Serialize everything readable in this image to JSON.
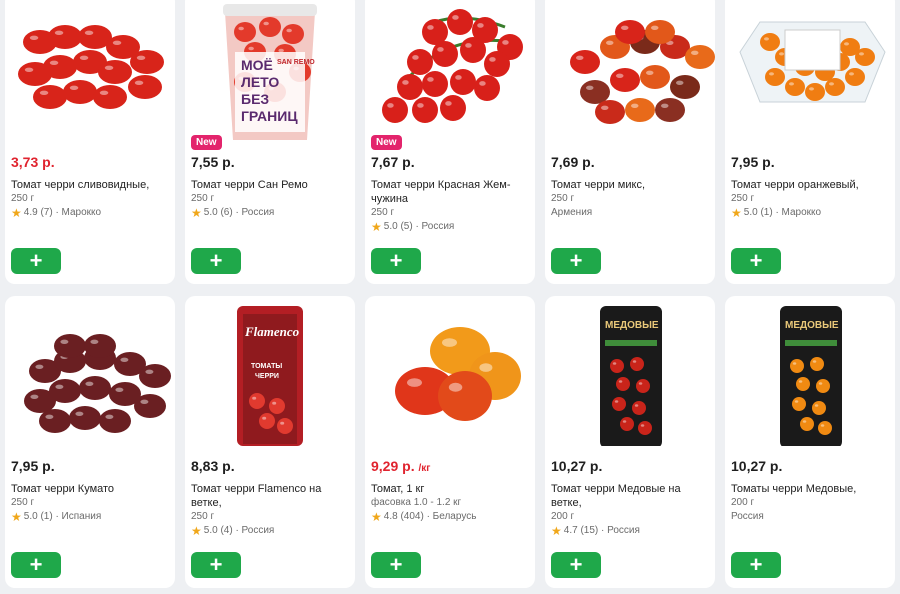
{
  "products": [
    {
      "price": "3,73 р.",
      "price_red": true,
      "unit": "",
      "badge": "",
      "title": "Томат черри сливовидные,",
      "weight": "250 г",
      "rating": "4.9 (7)",
      "country": "Марокко",
      "image": "red-plum-cherry-tomatoes"
    },
    {
      "price": "7,55 р.",
      "price_red": false,
      "unit": "",
      "badge": "New",
      "title": "Томат черри Сан Ремо",
      "weight": "250 г",
      "rating": "5.0 (6)",
      "country": "Россия",
      "image": "san-remo-cup",
      "image_text": [
        "МОЁ",
        "ЛЕТО",
        "БЕЗ",
        "ГРАНИЦ"
      ],
      "brand": "SAN REMO"
    },
    {
      "price": "7,67 р.",
      "price_red": false,
      "unit": "",
      "badge": "New",
      "title": "Томат черри Красная Жем-чужина",
      "weight": "250 г",
      "rating": "5.0 (5)",
      "country": "Россия",
      "image": "cherry-tomatoes-on-vine"
    },
    {
      "price": "7,69 р.",
      "price_red": false,
      "unit": "",
      "badge": "",
      "title": "Томат черри микс,",
      "weight": "250 г",
      "rating": "",
      "country": "Армения",
      "image": "mixed-cherry-tomatoes"
    },
    {
      "price": "7,95 р.",
      "price_red": false,
      "unit": "",
      "badge": "",
      "title": "Томат черри оранжевый,",
      "weight": "250 г",
      "rating": "5.0 (1)",
      "country": "Марокко",
      "image": "orange-cherry-tray"
    },
    {
      "price": "7,95 р.",
      "price_red": false,
      "unit": "",
      "badge": "",
      "title": "Томат черри Кумато",
      "weight": "250 г",
      "rating": "5.0 (1)",
      "country": "Испания",
      "image": "kumato-tomatoes"
    },
    {
      "price": "8,83 р.",
      "price_red": false,
      "unit": "",
      "badge": "",
      "title": "Томат черри Flamenco на ветке,",
      "weight": "250 г",
      "rating": "5.0 (4)",
      "country": "Россия",
      "image": "flamenco-pack",
      "image_text": [
        "Flamenco",
        "ТОМАТЫ",
        "ЧЕРРИ"
      ]
    },
    {
      "price": "9,29 р.",
      "price_red": true,
      "unit": "/кг",
      "badge": "",
      "title": "Томат, 1 кг",
      "weight": "фасовка 1.0 - 1.2 кг",
      "rating": "4.8 (404)",
      "country": "Беларусь",
      "image": "large-tomatoes"
    },
    {
      "price": "10,27 р.",
      "price_red": false,
      "unit": "",
      "badge": "",
      "title": "Томат черри Медовые на ветке,",
      "weight": "200 г",
      "rating": "4.7 (15)",
      "country": "Россия",
      "image": "medovye-red-pack",
      "image_text": [
        "МЕДОВЫЕ"
      ]
    },
    {
      "price": "10,27 р.",
      "price_red": false,
      "unit": "",
      "badge": "",
      "title": "Томаты черри Медовые,",
      "weight": "200 г",
      "rating": "",
      "country": "Россия",
      "image": "medovye-orange-pack",
      "image_text": [
        "МЕДОВЫЕ"
      ]
    }
  ],
  "add_label": "+",
  "rating_separator": "·",
  "colors": {
    "accent": "#1fa84a",
    "price_red": "#e0242f",
    "badge": "#e3246c",
    "star": "#f0a71a"
  }
}
